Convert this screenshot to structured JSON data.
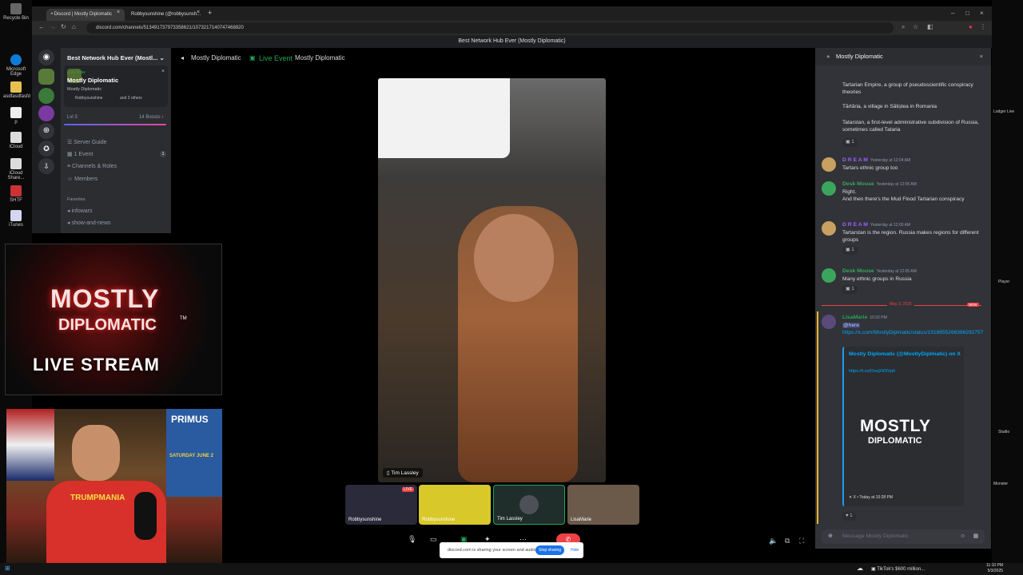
{
  "desktop": {
    "icons": [
      "Recycle Bin",
      "Microsoft Edge",
      "asdfasdfasfd",
      "p",
      "iCloud",
      "iCloud Share...",
      "SHTF",
      "iTunes"
    ],
    "right_icons": [
      "Lodger Live",
      "Player",
      "Studio",
      "Monster"
    ]
  },
  "browser": {
    "tabs": [
      {
        "label": "• Discord | Mostly Diplomatic"
      },
      {
        "label": "Robbysunshine (@robbysunsh..."
      }
    ],
    "new_tab": "+",
    "url": "discord.com/channels/513491737973358621/1073217140747468820"
  },
  "discord_title": "Best Network Hub Ever (Mostly Diplomatic)",
  "sidebar": {
    "server_name": "Best Network Hub Ever (Mostl...",
    "live_badge": "Live Now",
    "live_title": "Mostly Diplomatic",
    "live_sub": "Mostly Diplomatic",
    "live_users": "Robbysunshine",
    "live_others": "and 2 others",
    "level": "Lvl 3",
    "boosts": "14 Boosts",
    "items": [
      {
        "label": "Server Guide"
      },
      {
        "label": "1 Event",
        "badge": "1"
      },
      {
        "label": "Channels & Roles"
      },
      {
        "label": "Members"
      }
    ],
    "favorites_header": "Favorites",
    "channels": [
      "infowars",
      "show-and-news"
    ]
  },
  "stage": {
    "channel": "Mostly Diplomatic",
    "live_event": "Live Event",
    "event_name": "Mostly Diplomatic",
    "main_name": "Tim Lassley",
    "tiles": [
      {
        "name": "Robbysunshine",
        "live": "LIVE"
      },
      {
        "name": "Robbysunshine"
      },
      {
        "name": "Tim Lassley"
      },
      {
        "name": "LisaMarie"
      }
    ],
    "share_text": "discord.com is sharing your screen and audio.",
    "stop_sharing": "Stop sharing",
    "hide": "Hide"
  },
  "chat": {
    "title": "Mostly Diplomatic",
    "top_messages": [
      "Tartarian Empire, a group of pseudoscientific conspiracy theories",
      "Tărtăria, a village in Săliștea in Romania",
      "Tatarstan, a first-level administrative subdivision of Russia, sometimes called Tataria"
    ],
    "messages": [
      {
        "author": "D R E A M",
        "color": "#a05cff",
        "time": "Yesterday at 12:04 AM",
        "text": "Tartars ethnic group too"
      },
      {
        "author": "Desk Mouse",
        "color": "#3ba55d",
        "time": "Yesterday at 12:05 AM",
        "text": "Right.",
        "text2": "And then there's the Mud Flood Tartarian conspiracy"
      },
      {
        "author": "D R E A M",
        "color": "#a05cff",
        "time": "Yesterday at 12:05 AM",
        "text": "Tartarstan is the region. Russia makes regions for different groups"
      },
      {
        "author": "Desk Mouse",
        "color": "#3ba55d",
        "time": "Yesterday at 12:05 AM",
        "text": "Many ethnic groups in Russia"
      }
    ],
    "divider_date": "May 3, 2025",
    "new_badge": "NEW",
    "lisa": {
      "author": "LisaMarie",
      "time": "10:32 PM",
      "mention": "@here",
      "link": "https://x.com/MostlyDiplmatic/status/1918855266386292757",
      "embed_title": "Mostly Diplomatic (@MostlyDiplmatic) on X",
      "embed_link": "https://t.co/OxsjXK5Vp6",
      "embed_logo_1": "MOSTLY",
      "embed_logo_2": "DIPLOMATIC",
      "embed_footer": "X • Today at 10:28 PM"
    },
    "reaction_count": "1",
    "input_placeholder": "Message Mostly Diplomatic"
  },
  "overlay": {
    "logo_line1": "MOSTLY",
    "logo_line2": "DIPLOMATIC",
    "logo_tm": "TM",
    "logo_line3": "LIVE STREAM",
    "poster_text": "PRIMUS",
    "poster_date": "SATURDAY JUNE 2",
    "shirt_text": "TRUMPMANIA"
  },
  "taskbar": {
    "news": "TikTok's $600 million...",
    "time": "11:10 PM",
    "date": "5/3/2025"
  },
  "colors": {
    "discord_bg": "#313338",
    "live_green": "#23a55a",
    "blurple": "#5865f2",
    "stop_blue": "#1a73e8"
  }
}
